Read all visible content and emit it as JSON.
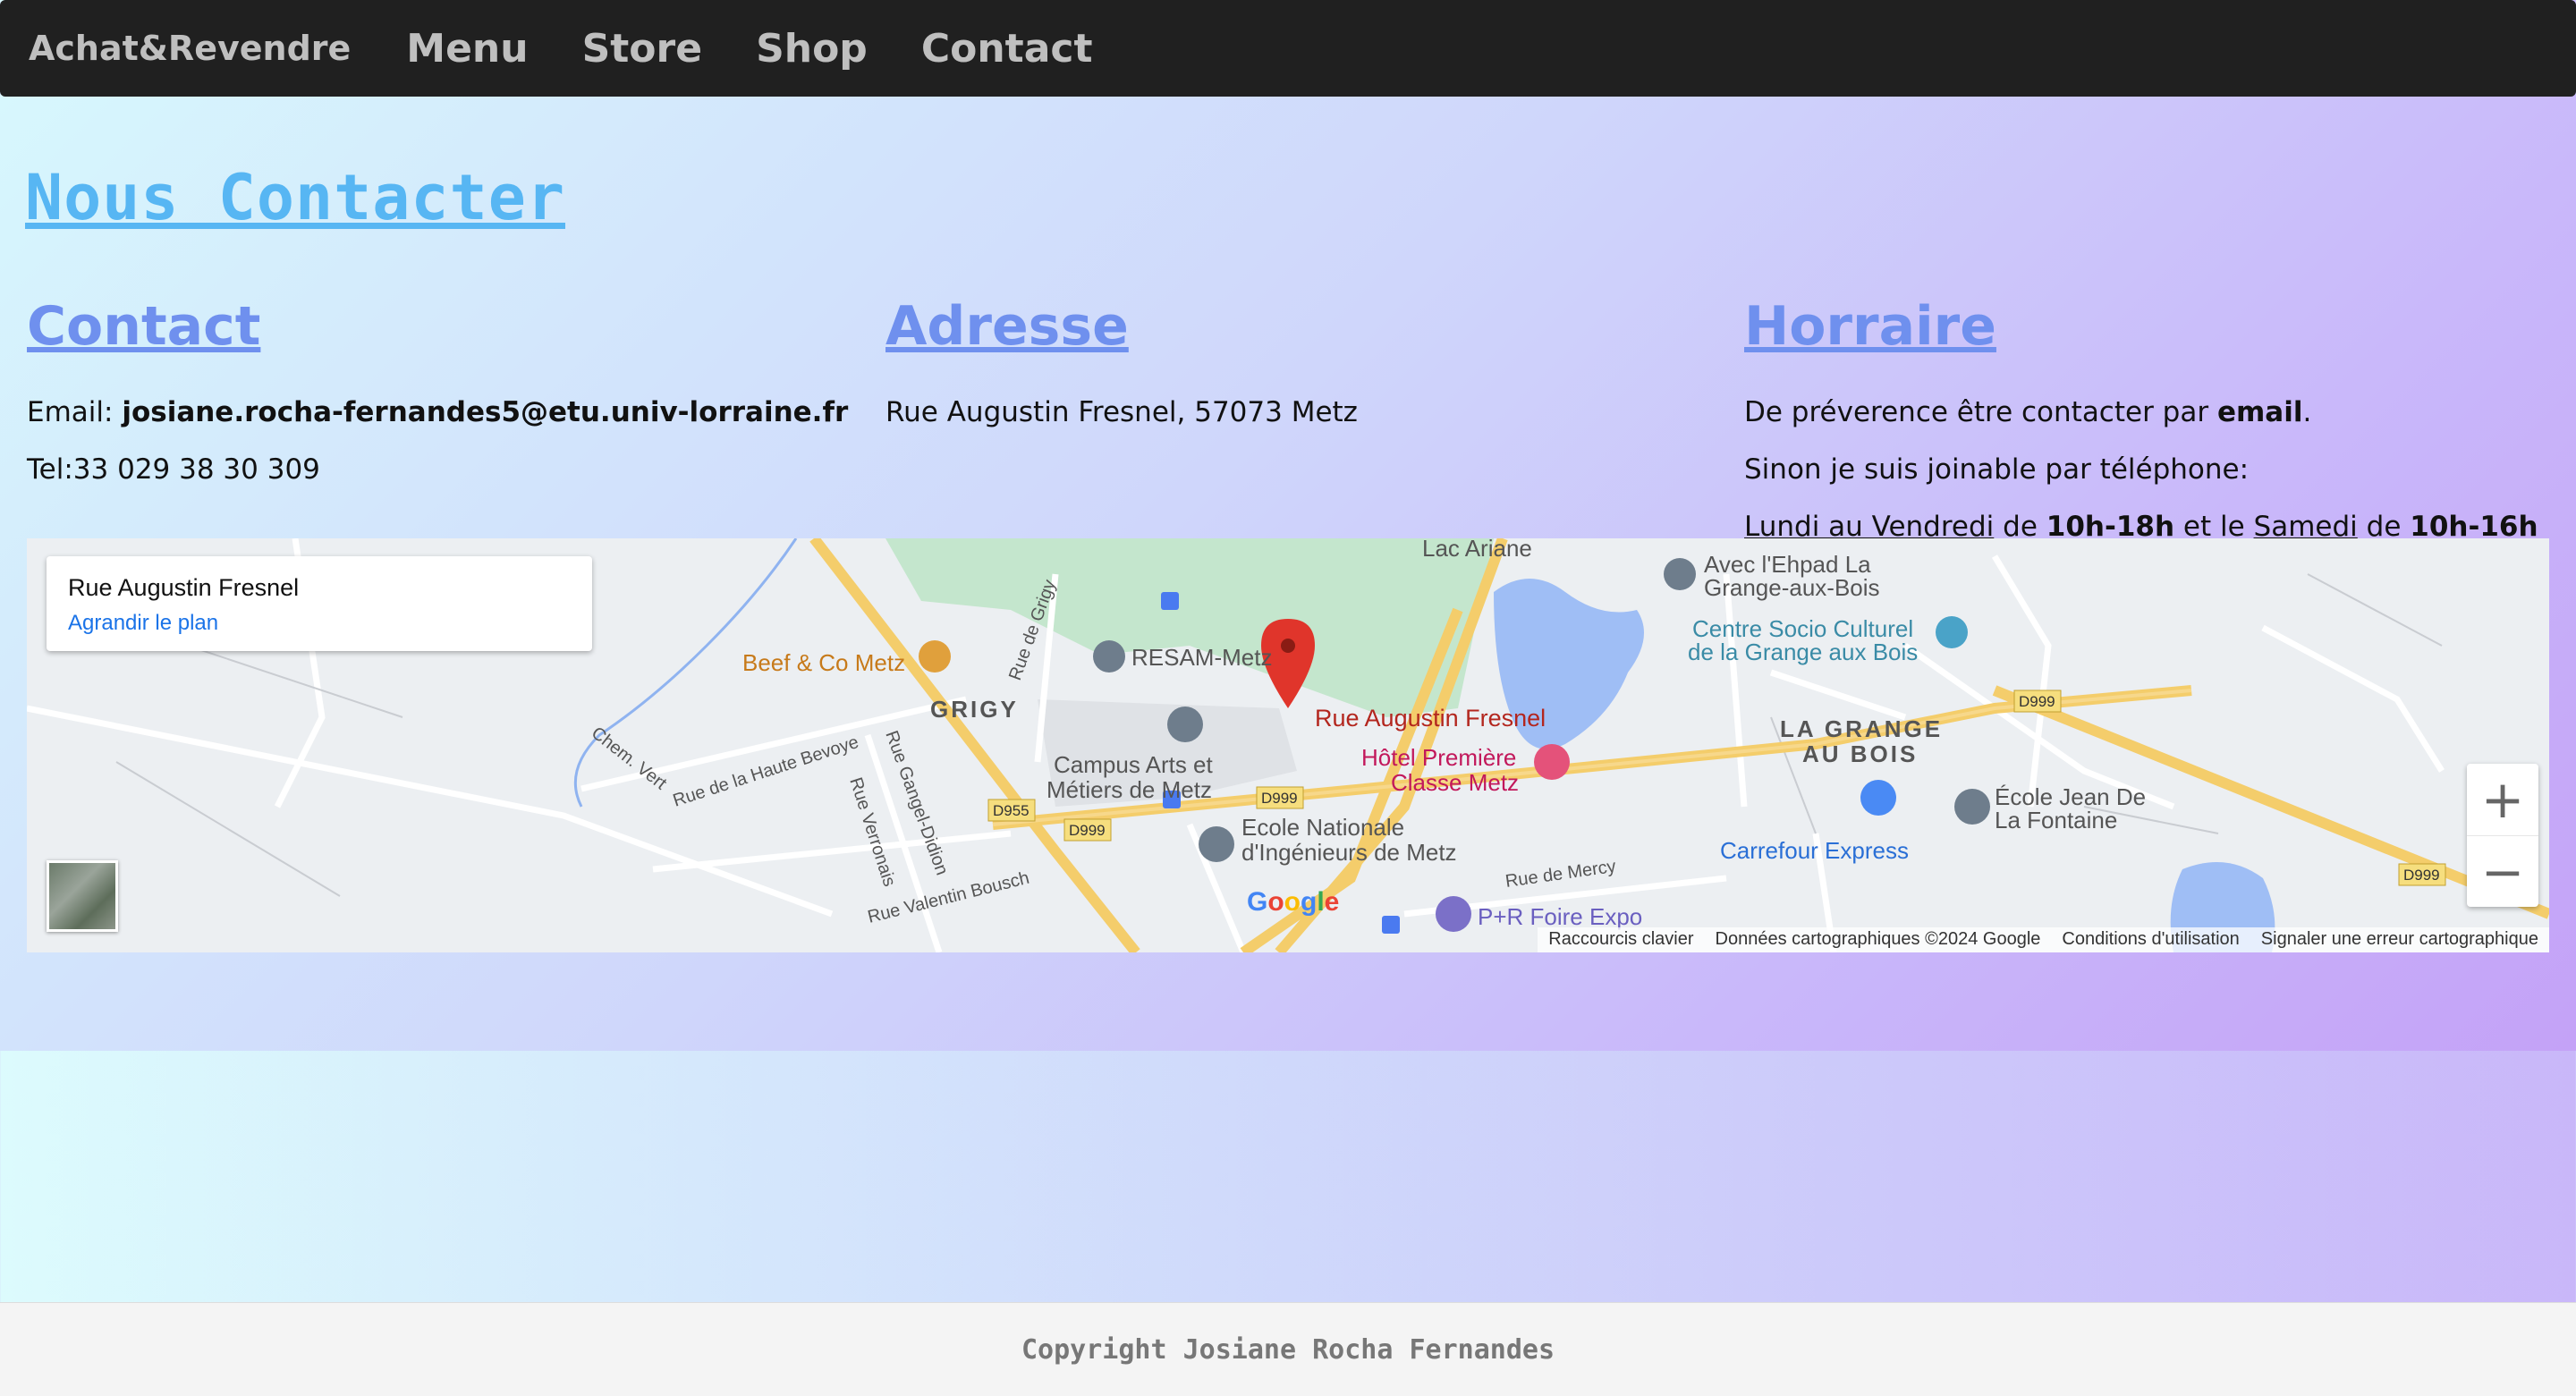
{
  "nav": {
    "brand": "Achat&Revendre",
    "links": [
      "Menu",
      "Store",
      "Shop",
      "Contact"
    ]
  },
  "page_title": "Nous Contacter",
  "contact": {
    "heading": "Contact",
    "email_label": "Email:",
    "email": "josiane.rocha-fernandes5@etu.univ-lorraine.fr",
    "tel": "Tel:33 029 38 30 309"
  },
  "address": {
    "heading": "Adresse",
    "text": "Rue Augustin Fresnel, 57073 Metz"
  },
  "hours": {
    "heading": "Horraire",
    "line1_pre": "De préverence être contacter par ",
    "line1_bold": "email",
    "line1_post": ".",
    "line2": "Sinon je suis joinable par téléphone:",
    "weekday_label": "Lundi au Vendredi",
    "de1": " de ",
    "weekday_hours": "10h-18h",
    "and": " et le ",
    "saturday_label": "Samedi",
    "de2": " de ",
    "saturday_hours": "10h-16h"
  },
  "map": {
    "card_title": "Rue Augustin Fresnel",
    "card_link": "Agrandir le plan",
    "labels": {
      "marker": "Rue Augustin Fresnel",
      "beef": "Beef & Co Metz",
      "grigy": "GRIGY",
      "resam": "RESAM-Metz",
      "campus1": "Campus Arts et",
      "campus2": "Métiers de Metz",
      "ecole1": "Ecole Nationale",
      "ecole2": "d'Ingénieurs de Metz",
      "hotel1": "Hôtel Première",
      "hotel2": "Classe Metz",
      "lac": "Lac Ariane",
      "ehpad1": "Avec l'Ehpad La",
      "ehpad2": "Grange-aux-Bois",
      "csc1": "Centre Socio Culturel",
      "csc2": "de la Grange aux Bois",
      "grange1": "LA GRANGE",
      "grange2": "AU BOIS",
      "carrefour": "Carrefour Express",
      "ejdlf1": "École Jean De",
      "ejdlf2": "La Fontaine",
      "pr": "P+R Foire Expo",
      "rue_mercy": "Rue de Mercy",
      "rue_haute": "Rue de la Haute Bevoye",
      "rue_valentin": "Rue Valentin Bousch",
      "rue_gangel": "Rue Gangel-Didion",
      "rue_verronais": "Rue Verronais",
      "chem_vert": "Chem. Vert",
      "rue_grigy": "Rue de Grigy",
      "d955": "D955",
      "d999": "D999"
    },
    "google": "Google",
    "attribution": [
      "Raccourcis clavier",
      "Données cartographiques ©2024 Google",
      "Conditions d'utilisation",
      "Signaler une erreur cartographique"
    ],
    "zoom_in": "+",
    "zoom_out": "−"
  },
  "footer": "Copyright Josiane Rocha Fernandes"
}
